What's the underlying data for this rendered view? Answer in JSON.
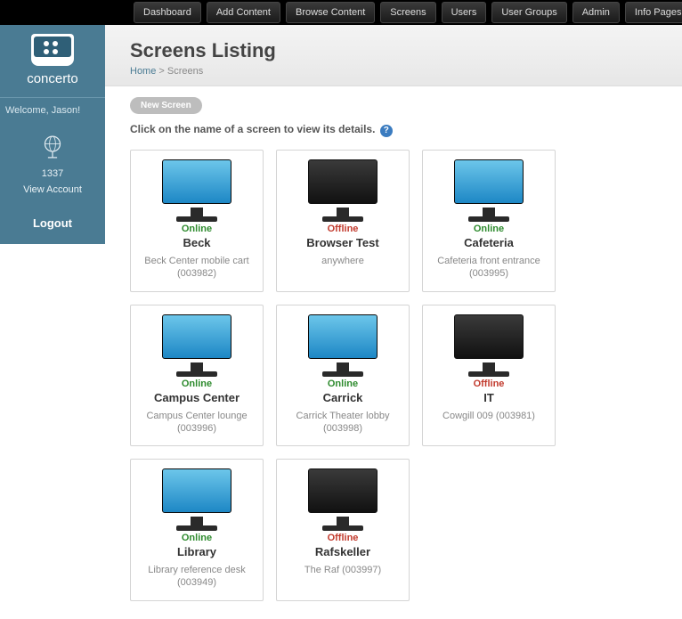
{
  "nav": [
    "Dashboard",
    "Add Content",
    "Browse Content",
    "Screens",
    "Users",
    "User Groups",
    "Admin",
    "Info Pages"
  ],
  "brand": "concerto",
  "sidebar": {
    "welcome": "Welcome, Jason!",
    "count": "1337",
    "view_account": "View Account",
    "logout": "Logout"
  },
  "header": {
    "title": "Screens Listing",
    "crumb_home": "Home",
    "crumb_sep": " > ",
    "crumb_current": "Screens"
  },
  "toolbar": {
    "new_screen": "New Screen"
  },
  "instruction": "Click on the name of a screen to view its details.",
  "screens": [
    {
      "status": "Online",
      "name": "Beck",
      "location": "Beck Center mobile cart",
      "id": "(003982)"
    },
    {
      "status": "Offline",
      "name": "Browser Test",
      "location": "anywhere",
      "id": ""
    },
    {
      "status": "Online",
      "name": "Cafeteria",
      "location": "Cafeteria front entrance",
      "id": "(003995)"
    },
    {
      "status": "Online",
      "name": "Campus Center",
      "location": "Campus Center lounge",
      "id": "(003996)"
    },
    {
      "status": "Online",
      "name": "Carrick",
      "location": "Carrick Theater lobby",
      "id": "(003998)"
    },
    {
      "status": "Offline",
      "name": "IT",
      "location": "Cowgill 009 (003981)",
      "id": ""
    },
    {
      "status": "Online",
      "name": "Library",
      "location": "Library reference desk",
      "id": "(003949)"
    },
    {
      "status": "Offline",
      "name": "Rafskeller",
      "location": "The Raf (003997)",
      "id": ""
    }
  ]
}
